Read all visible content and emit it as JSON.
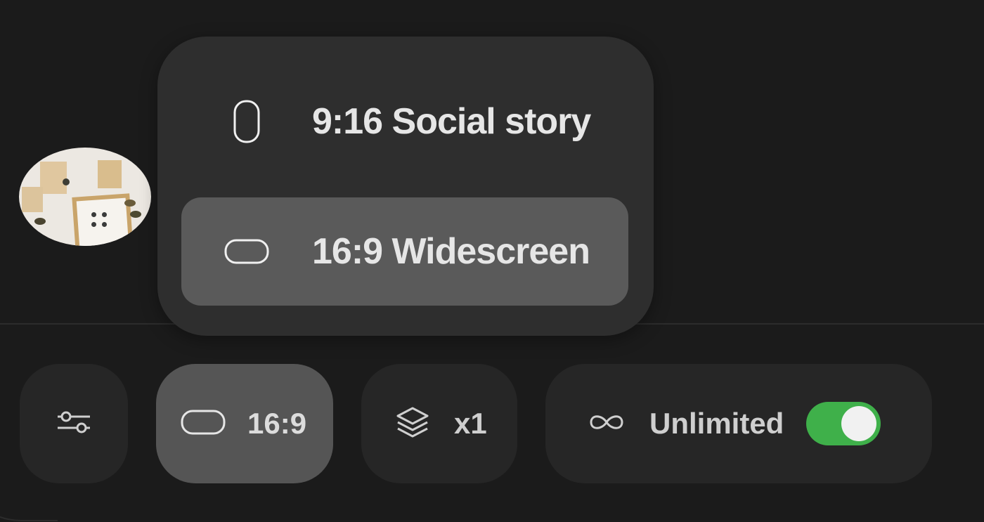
{
  "aspect_menu": {
    "options": [
      {
        "label": "9:16 Social story",
        "icon": "portrait-ratio-icon",
        "selected": false
      },
      {
        "label": "16:9 Widescreen",
        "icon": "landscape-ratio-icon",
        "selected": true
      }
    ]
  },
  "toolbar": {
    "settings_icon": "sliders-icon",
    "aspect_ratio_label": "16:9",
    "aspect_ratio_icon": "landscape-ratio-icon",
    "count_label": "x1",
    "count_icon": "layers-icon",
    "unlimited_label": "Unlimited",
    "unlimited_icon": "infinity-icon",
    "unlimited_enabled": true
  },
  "colors": {
    "background": "#1b1b1b",
    "popup": "#2e2e2e",
    "selected_item": "#5a5a5a",
    "pill": "#262626",
    "active_pill": "#555555",
    "toggle_on": "#3fb04a"
  }
}
